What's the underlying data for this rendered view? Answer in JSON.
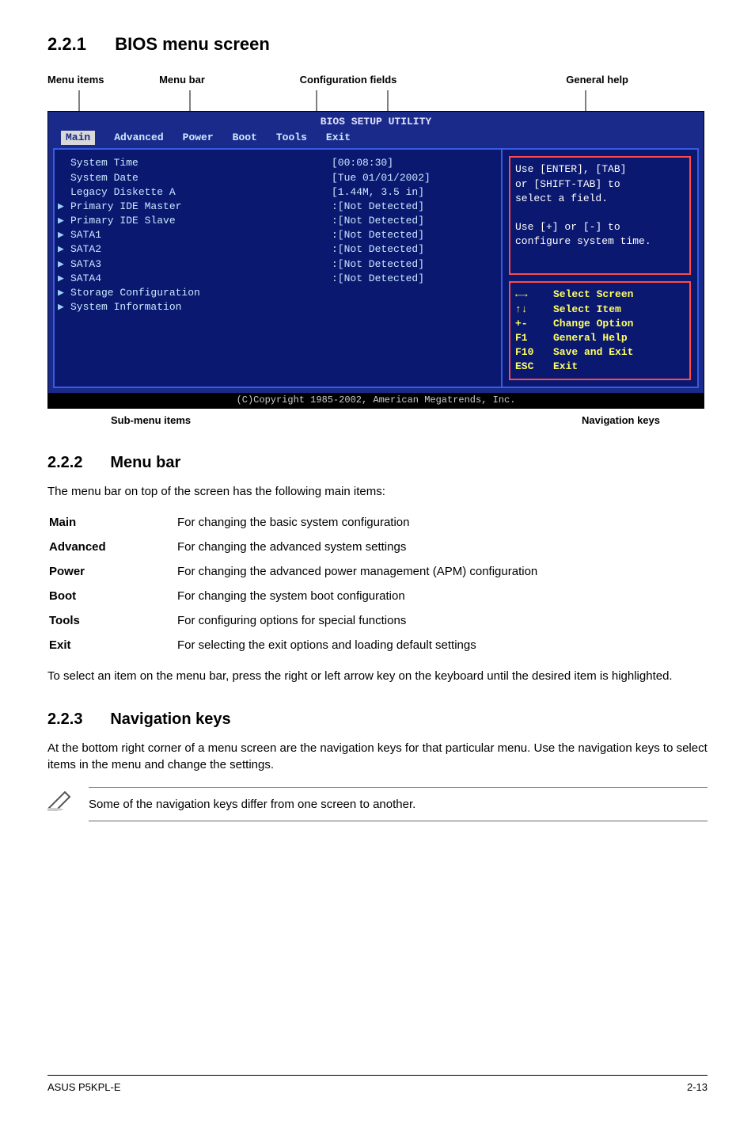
{
  "section1": {
    "num": "2.2.1",
    "title": "BIOS menu screen"
  },
  "bios_labels": {
    "menu_items": "Menu items",
    "menu_bar": "Menu bar",
    "config_fields": "Configuration fields",
    "general_help": "General help",
    "sub_menu": "Sub-menu items",
    "nav_keys": "Navigation keys"
  },
  "bios": {
    "title": "BIOS SETUP UTILITY",
    "tabs": [
      "Main",
      "Advanced",
      "Power",
      "Boot",
      "Tools",
      "Exit"
    ],
    "items": [
      {
        "marker": "",
        "label": "System Time",
        "value": "[00:08:30]"
      },
      {
        "marker": "",
        "label": "System Date",
        "value": "[Tue 01/01/2002]"
      },
      {
        "marker": "",
        "label": "Legacy Diskette A",
        "value": "[1.44M, 3.5 in]"
      },
      {
        "marker": "",
        "label": "",
        "value": ""
      },
      {
        "marker": "▶",
        "label": "Primary IDE Master",
        "value": ":[Not Detected]"
      },
      {
        "marker": "▶",
        "label": "Primary IDE Slave",
        "value": ":[Not Detected]"
      },
      {
        "marker": "▶",
        "label": "SATA1",
        "value": ":[Not Detected]"
      },
      {
        "marker": "▶",
        "label": "SATA2",
        "value": ":[Not Detected]"
      },
      {
        "marker": "▶",
        "label": "SATA3",
        "value": ":[Not Detected]"
      },
      {
        "marker": "▶",
        "label": "SATA4",
        "value": ":[Not Detected]"
      },
      {
        "marker": "",
        "label": "",
        "value": ""
      },
      {
        "marker": "▶",
        "label": "Storage Configuration",
        "value": ""
      },
      {
        "marker": "",
        "label": "",
        "value": ""
      },
      {
        "marker": "▶",
        "label": "System Information",
        "value": ""
      },
      {
        "marker": "",
        "label": "",
        "value": ""
      },
      {
        "marker": "",
        "label": "",
        "value": ""
      }
    ],
    "help_top": "Use [ENTER], [TAB]\nor [SHIFT-TAB] to\nselect a field.\n\nUse [+] or [-] to\nconfigure system time.",
    "navkeys": [
      {
        "key": "←→",
        "desc": "Select Screen"
      },
      {
        "key": "↑↓",
        "desc": "Select Item"
      },
      {
        "key": "+-",
        "desc": "Change Option"
      },
      {
        "key": "F1",
        "desc": "General Help"
      },
      {
        "key": "F10",
        "desc": "Save and Exit"
      },
      {
        "key": "ESC",
        "desc": "Exit"
      }
    ],
    "footer": "(C)Copyright 1985-2002, American Megatrends, Inc."
  },
  "section2": {
    "num": "2.2.2",
    "title": "Menu bar",
    "intro": "The menu bar on top of the screen has the following main items:",
    "rows": [
      {
        "k": "Main",
        "v": "For changing the basic system configuration"
      },
      {
        "k": "Advanced",
        "v": "For changing the advanced system settings"
      },
      {
        "k": "Power",
        "v": "For changing the advanced power management (APM) configuration"
      },
      {
        "k": "Boot",
        "v": "For changing the system boot configuration"
      },
      {
        "k": "Tools",
        "v": "For configuring options for special functions"
      },
      {
        "k": "Exit",
        "v": "For selecting the exit options and loading default settings"
      }
    ],
    "outro": "To select an item on the menu bar, press the right or left arrow key on the keyboard until the desired item is highlighted."
  },
  "section3": {
    "num": "2.2.3",
    "title": "Navigation keys",
    "body": "At the bottom right corner of a menu screen are the navigation keys for that particular menu. Use the navigation keys to select items in the menu and change the settings.",
    "note": "Some of the navigation keys differ from one screen to another."
  },
  "footer": {
    "left": "ASUS P5KPL-E",
    "right": "2-13"
  }
}
